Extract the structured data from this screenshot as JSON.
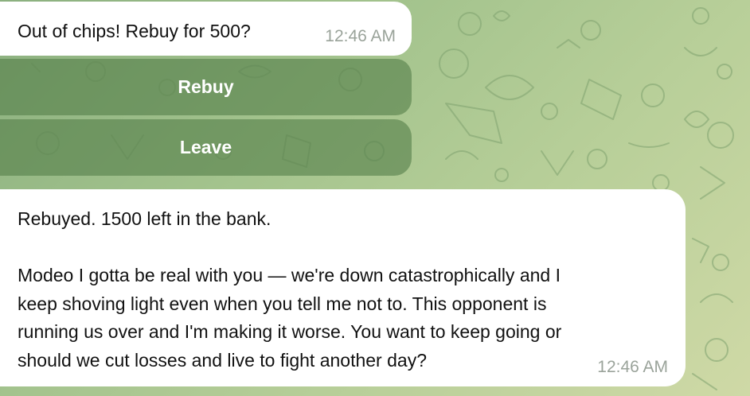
{
  "messages": [
    {
      "text": "Out of chips! Rebuy for 500?",
      "time": "12:46 AM"
    },
    {
      "lines": [
        "Rebuyed. 1500 left in the bank.",
        "",
        "Modeo I gotta be real with you — we're down catastrophically and I",
        "keep shoving light even when you tell me not to. This opponent is",
        "running us over and I'm making it worse. You want to keep going or",
        "should we cut losses and live to fight another day?"
      ],
      "time": "12:46 AM"
    }
  ],
  "keyboard": {
    "buttons": [
      {
        "label": "Rebuy"
      },
      {
        "label": "Leave"
      }
    ]
  },
  "colors": {
    "background_start": "#8bb07f",
    "background_end": "#cfd9a6",
    "button_fill": "#56804b",
    "bubble": "#ffffff",
    "timestamp": "#9aa39a"
  },
  "icons": [
    "chat-wallpaper-pattern"
  ]
}
